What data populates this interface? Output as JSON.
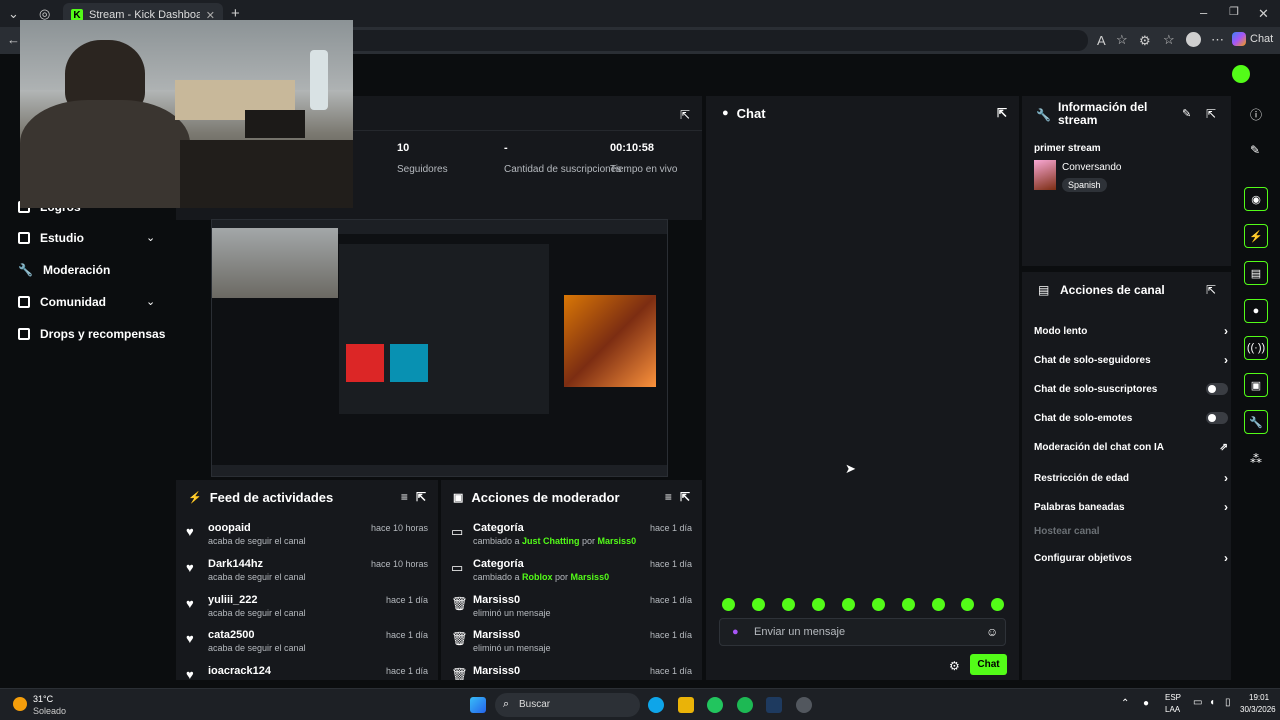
{
  "browser": {
    "tab_title": "Stream - Kick Dashboard",
    "tab_favicon_letter": "K",
    "profile_button": "Chat"
  },
  "sidebar": {
    "items": [
      {
        "label": "Logros",
        "icon": "trophy-icon"
      },
      {
        "label": "Estudio",
        "icon": "studio-icon",
        "expandable": true
      },
      {
        "label": "Moderación",
        "icon": "wrench-icon"
      },
      {
        "label": "Comunidad",
        "icon": "community-icon",
        "expandable": true
      },
      {
        "label": "Drops y recompensas",
        "icon": "gift-icon"
      }
    ]
  },
  "stats": {
    "items": [
      {
        "value": "10",
        "label": "Seguidores"
      },
      {
        "value": "-",
        "label": "Cantidad de suscripciones"
      },
      {
        "value": "00:10:58",
        "label": "Tiempo en vivo"
      }
    ]
  },
  "chat": {
    "title": "Chat",
    "input_placeholder": "Enviar un mensaje",
    "send_label": "Chat"
  },
  "stream_info": {
    "title": "Información del stream",
    "stream_title": "primer stream",
    "category": "Conversando",
    "language": "Spanish"
  },
  "channel_actions": {
    "title": "Acciones de canal",
    "items": [
      {
        "label": "Modo lento",
        "control": "chevron"
      },
      {
        "label": "Chat de solo-seguidores",
        "control": "chevron"
      },
      {
        "label": "Chat de solo-suscriptores",
        "control": "toggle",
        "on": false
      },
      {
        "label": "Chat de solo-emotes",
        "control": "toggle",
        "on": false
      },
      {
        "label": "Moderación del chat con IA",
        "control": "external"
      },
      {
        "label": "Restricción de edad",
        "control": "chevron"
      },
      {
        "label": "Palabras baneadas",
        "control": "chevron"
      },
      {
        "label": "Hostear canal",
        "control": "none",
        "disabled": true
      },
      {
        "label": "Configurar objetivos",
        "control": "chevron"
      }
    ]
  },
  "activity_feed": {
    "title": "Feed de actividades",
    "items": [
      {
        "name": "ooopaid",
        "action": "acaba de seguir el canal",
        "time": "hace 10 horas"
      },
      {
        "name": "Dark144hz",
        "action": "acaba de seguir el canal",
        "time": "hace 10 horas"
      },
      {
        "name": "yuliii_222",
        "action": "acaba de seguir el canal",
        "time": "hace 1 día"
      },
      {
        "name": "cata2500",
        "action": "acaba de seguir el canal",
        "time": "hace 1 día"
      },
      {
        "name": "ioacrack124",
        "action": "",
        "time": "hace 1 día"
      }
    ]
  },
  "mod_actions": {
    "title": "Acciones de moderador",
    "items": [
      {
        "title": "Categoría",
        "pre": "cambiado a ",
        "target": "Just Chatting",
        "mid": " por ",
        "user": "Marsiss0",
        "time": "hace 1 día",
        "icon": "category-icon"
      },
      {
        "title": "Categoría",
        "pre": "cambiado a ",
        "target": "Roblox",
        "mid": " por ",
        "user": "Marsiss0",
        "time": "hace 1 día",
        "icon": "category-icon"
      },
      {
        "title": "Marsiss0",
        "pre": "eliminó un mensaje",
        "target": "",
        "mid": "",
        "user": "",
        "time": "hace 1 día",
        "icon": "trash-icon"
      },
      {
        "title": "Marsiss0",
        "pre": "eliminó un mensaje",
        "target": "",
        "mid": "",
        "user": "",
        "time": "hace 1 día",
        "icon": "trash-icon"
      },
      {
        "title": "Marsiss0",
        "pre": "",
        "target": "",
        "mid": "",
        "user": "",
        "time": "hace 1 día",
        "icon": "trash-icon"
      }
    ]
  },
  "taskbar": {
    "weather_temp": "31°C",
    "weather_desc": "Soleado",
    "search_label": "Buscar",
    "lang_top": "ESP",
    "lang_bottom": "LAA",
    "time": "19:01",
    "date": "30/3/2026"
  },
  "colors": {
    "accent": "#53fc18",
    "panel": "#16181c",
    "background": "#0b0d0f"
  }
}
